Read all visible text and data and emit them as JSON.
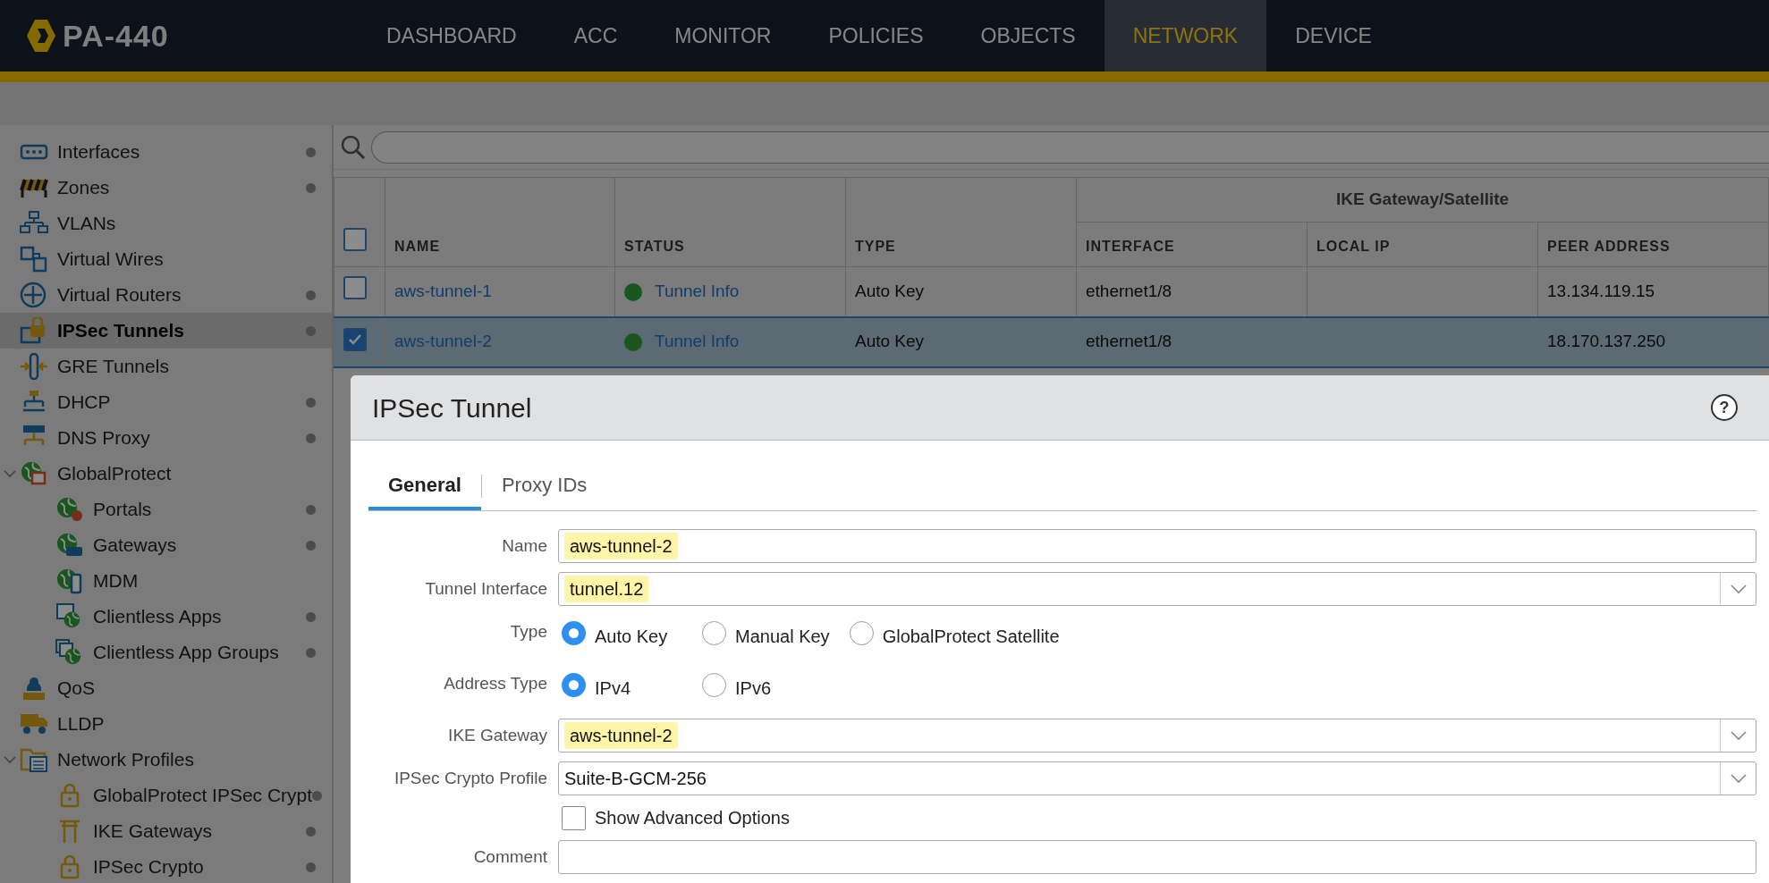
{
  "app": {
    "logo": "PA-440"
  },
  "nav": [
    {
      "label": "DASHBOARD",
      "selected": false
    },
    {
      "label": "ACC",
      "selected": false
    },
    {
      "label": "MONITOR",
      "selected": false
    },
    {
      "label": "POLICIES",
      "selected": false
    },
    {
      "label": "OBJECTS",
      "selected": false
    },
    {
      "label": "NETWORK",
      "selected": true
    },
    {
      "label": "DEVICE",
      "selected": false
    }
  ],
  "sidebar": {
    "items": [
      {
        "label": "Interfaces",
        "indicator": true,
        "selected": false
      },
      {
        "label": "Zones",
        "indicator": true,
        "selected": false
      },
      {
        "label": "VLANs",
        "indicator": false,
        "selected": false
      },
      {
        "label": "Virtual Wires",
        "indicator": false,
        "selected": false
      },
      {
        "label": "Virtual Routers",
        "indicator": true,
        "selected": false
      },
      {
        "label": "IPSec Tunnels",
        "indicator": true,
        "selected": true
      },
      {
        "label": "GRE Tunnels",
        "indicator": false,
        "selected": false
      },
      {
        "label": "DHCP",
        "indicator": true,
        "selected": false
      },
      {
        "label": "DNS Proxy",
        "indicator": true,
        "selected": false
      },
      {
        "label": "GlobalProtect",
        "indicator": false,
        "selected": false,
        "expanded": true,
        "children": [
          {
            "label": "Portals",
            "indicator": true,
            "selected": false
          },
          {
            "label": "Gateways",
            "indicator": true,
            "selected": false
          },
          {
            "label": "MDM",
            "indicator": false,
            "selected": false
          },
          {
            "label": "Clientless Apps",
            "indicator": true,
            "selected": false
          },
          {
            "label": "Clientless App Groups",
            "indicator": true,
            "selected": false
          }
        ]
      },
      {
        "label": "QoS",
        "indicator": false,
        "selected": false
      },
      {
        "label": "LLDP",
        "indicator": false,
        "selected": false
      },
      {
        "label": "Network Profiles",
        "indicator": false,
        "selected": false,
        "expanded": true,
        "children": [
          {
            "label": "GlobalProtect IPSec Crypt",
            "indicator": true,
            "selected": false
          },
          {
            "label": "IKE Gateways",
            "indicator": true,
            "selected": false
          },
          {
            "label": "IPSec Crypto",
            "indicator": true,
            "selected": false
          }
        ]
      }
    ]
  },
  "table": {
    "all_checked": false,
    "group_header": "IKE Gateway/Satellite",
    "columns": [
      "NAME",
      "STATUS",
      "TYPE",
      "INTERFACE",
      "LOCAL IP",
      "PEER ADDRESS"
    ],
    "rows": [
      {
        "checked": false,
        "selected": false,
        "name": "aws-tunnel-1",
        "tunnel_up": true,
        "status": "Tunnel Info",
        "type": "Auto Key",
        "interface": "ethernet1/8",
        "peer_address": "13.134.119.15"
      },
      {
        "checked": true,
        "selected": true,
        "name": "aws-tunnel-2",
        "tunnel_up": true,
        "status": "Tunnel Info",
        "type": "Auto Key",
        "interface": "ethernet1/8",
        "peer_address": "18.170.137.250"
      }
    ]
  },
  "dialog": {
    "title": "IPSec Tunnel",
    "help": "?",
    "tabs": [
      {
        "label": "General",
        "selected": true
      },
      {
        "label": "Proxy IDs",
        "selected": false
      }
    ],
    "fields": [
      {
        "kind": "text",
        "label": "Name",
        "value": "aws-tunnel-2",
        "highlighted": true
      },
      {
        "kind": "select",
        "label": "Tunnel Interface",
        "value": "tunnel.12",
        "highlighted": true
      },
      {
        "kind": "radio",
        "label": "Type",
        "options": [
          {
            "label": "Auto Key",
            "selected": true
          },
          {
            "label": "Manual Key",
            "selected": false
          },
          {
            "label": "GlobalProtect Satellite",
            "selected": false
          }
        ]
      },
      {
        "kind": "radio",
        "label": "Address Type",
        "options": [
          {
            "label": "IPv4",
            "selected": true
          },
          {
            "label": "IPv6",
            "selected": false
          }
        ]
      },
      {
        "kind": "select",
        "label": "IKE Gateway",
        "value": "aws-tunnel-2",
        "highlighted": true
      },
      {
        "kind": "select",
        "label": "IPSec Crypto Profile",
        "value": "Suite-B-GCM-256",
        "highlighted": false
      },
      {
        "kind": "checkbox",
        "label": "Show Advanced Options",
        "checked": false
      },
      {
        "kind": "text",
        "label": "Comment"
      }
    ]
  }
}
